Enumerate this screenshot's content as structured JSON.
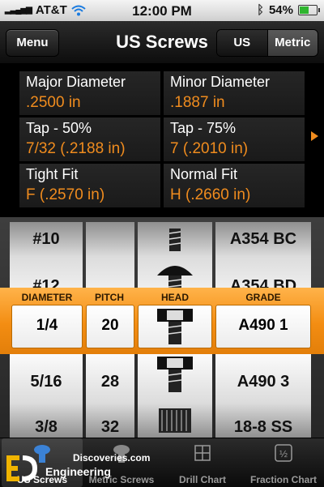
{
  "status_bar": {
    "carrier": "AT&T",
    "time": "12:00 PM",
    "battery_text": "54%",
    "battery_level": 0.54
  },
  "nav": {
    "menu_label": "Menu",
    "title": "US Screws",
    "unit_us": "US",
    "unit_metric": "Metric"
  },
  "info": {
    "major_label": "Major Diameter",
    "major_value": ".2500 in",
    "minor_label": "Minor Diameter",
    "minor_value": ".1887 in",
    "tap50_label": "Tap - 50%",
    "tap50_value": "7/32 (.2188 in)",
    "tap75_label": "Tap - 75%",
    "tap75_value": "7 (.2010 in)",
    "tight_label": "Tight Fit",
    "tight_value": "F (.2570 in)",
    "normal_label": "Normal Fit",
    "normal_value": "H (.2660 in)"
  },
  "picker": {
    "headers": {
      "diameter": "DIAMETER",
      "pitch": "PITCH",
      "head": "HEAD",
      "grade": "GRADE"
    },
    "diameter": {
      "above": [
        "#10",
        "#12"
      ],
      "selected": "1/4",
      "below": [
        "5/16",
        "3/8"
      ]
    },
    "pitch": {
      "above": [
        "",
        ""
      ],
      "selected": "20",
      "below": [
        "28",
        "32"
      ]
    },
    "grade": {
      "above": [
        "A354 BC",
        "A354 BD"
      ],
      "selected": "A490 1",
      "below": [
        "A490 3",
        "18-8 SS"
      ]
    }
  },
  "tabs": {
    "us_screws": "US Screws",
    "metric_screws": "Metric Screws",
    "drill_chart": "Drill Chart",
    "fraction_chart": "Fraction Chart"
  },
  "watermark": {
    "line1": "Discoveries.com",
    "line2": "Engineering",
    "logo_letters": "EDUS"
  },
  "colors": {
    "accent_orange": "#f08c1e",
    "selection_bar": "#f38d12"
  }
}
